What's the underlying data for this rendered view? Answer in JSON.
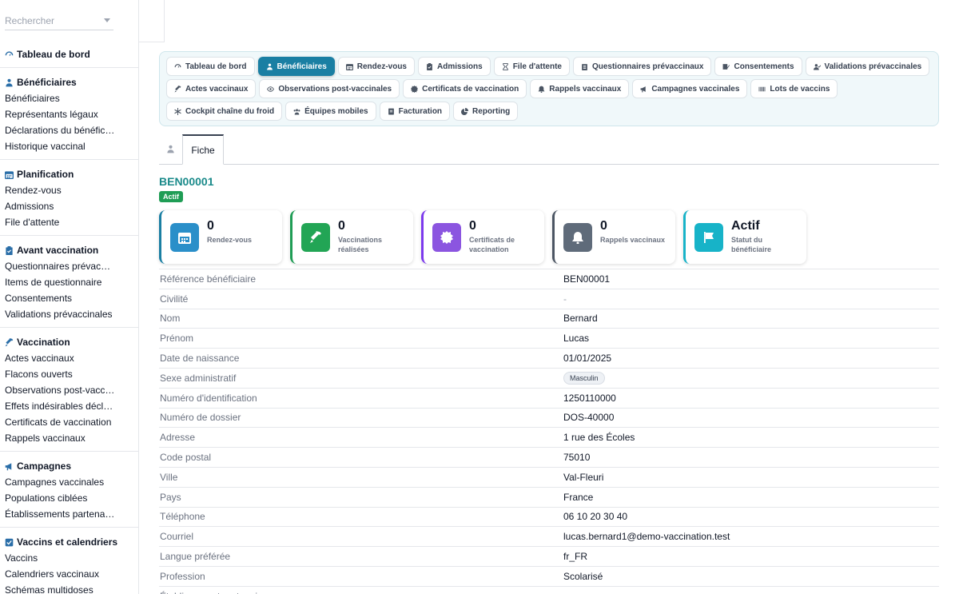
{
  "search": {
    "placeholder": "Rechercher"
  },
  "sidebar": {
    "top": "Tableau de bord",
    "sections": [
      {
        "title": "Bénéficiaires",
        "icon": "users-icon",
        "items": [
          "Bénéficiaires",
          "Représentants légaux",
          "Déclarations du bénéficia…",
          "Historique vaccinal"
        ]
      },
      {
        "title": "Planification",
        "icon": "calendar-icon",
        "items": [
          "Rendez-vous",
          "Admissions",
          "File d'attente"
        ]
      },
      {
        "title": "Avant vaccination",
        "icon": "clipboard-icon",
        "items": [
          "Questionnaires prévaccin…",
          "Items de questionnaire",
          "Consentements",
          "Validations prévaccinales"
        ]
      },
      {
        "title": "Vaccination",
        "icon": "syringe-icon",
        "items": [
          "Actes vaccinaux",
          "Flacons ouverts",
          "Observations post-vaccin…",
          "Effets indésirables déclarés",
          "Certificats de vaccination",
          "Rappels vaccinaux"
        ]
      },
      {
        "title": "Campagnes",
        "icon": "megaphone-icon",
        "items": [
          "Campagnes vaccinales",
          "Populations ciblées",
          "Établissements partenaires"
        ]
      },
      {
        "title": "Vaccins et calendriers",
        "icon": "check-square-icon",
        "items": [
          "Vaccins",
          "Calendriers vaccinaux",
          "Schémas multidoses"
        ]
      }
    ]
  },
  "tabs": [
    {
      "label": "Tableau de bord",
      "icon": "dashboard-icon",
      "active": false
    },
    {
      "label": "Bénéficiaires",
      "icon": "users-icon",
      "active": true
    },
    {
      "label": "Rendez-vous",
      "icon": "calendar-icon",
      "active": false
    },
    {
      "label": "Admissions",
      "icon": "clipboard-icon",
      "active": false
    },
    {
      "label": "File d'attente",
      "icon": "hourglass-icon",
      "active": false
    },
    {
      "label": "Questionnaires prévaccinaux",
      "icon": "clipboard-list-icon",
      "active": false
    },
    {
      "label": "Consentements",
      "icon": "signature-icon",
      "active": false
    },
    {
      "label": "Validations prévaccinales",
      "icon": "user-check-icon",
      "active": false
    },
    {
      "label": "Actes vaccinaux",
      "icon": "syringe-icon",
      "active": false
    },
    {
      "label": "Observations post-vaccinales",
      "icon": "eye-icon",
      "active": false
    },
    {
      "label": "Certificats de vaccination",
      "icon": "certificate-icon",
      "active": false
    },
    {
      "label": "Rappels vaccinaux",
      "icon": "bell-icon",
      "active": false
    },
    {
      "label": "Campagnes vaccinales",
      "icon": "megaphone-icon",
      "active": false
    },
    {
      "label": "Lots de vaccins",
      "icon": "barcode-icon",
      "active": false
    },
    {
      "label": "Cockpit chaîne du froid",
      "icon": "snowflake-icon",
      "active": false
    },
    {
      "label": "Équipes mobiles",
      "icon": "team-icon",
      "active": false
    },
    {
      "label": "Facturation",
      "icon": "invoice-icon",
      "active": false
    },
    {
      "label": "Reporting",
      "icon": "pie-chart-icon",
      "active": false
    }
  ],
  "subtabs": {
    "fiche": "Fiche"
  },
  "record": {
    "reference": "BEN00001",
    "status_badge": "Actif"
  },
  "cards": [
    {
      "value": "0",
      "label": "Rendez-vous",
      "icon": "calendar-icon",
      "color": "#2a8fc9",
      "border": "#1a7fa3"
    },
    {
      "value": "0",
      "label": "Vaccinations réalisées",
      "icon": "syringe-icon",
      "color": "#22a555",
      "border": "#1f9d55"
    },
    {
      "value": "0",
      "label": "Certificats de vaccination",
      "icon": "certificate-icon",
      "color": "#8b55e0",
      "border": "#7c3aed"
    },
    {
      "value": "0",
      "label": "Rappels vaccinaux",
      "icon": "bell-icon",
      "color": "#5f6b7a",
      "border": "#4b5563"
    },
    {
      "value": "Actif",
      "label": "Statut du bénéficiaire",
      "icon": "flag-icon",
      "color": "#17b3c8",
      "border": "#17b3c8"
    }
  ],
  "fields": [
    {
      "label": "Référence bénéficiaire",
      "value": "BEN00001"
    },
    {
      "label": "Civilité",
      "value": "-"
    },
    {
      "label": "Nom",
      "value": "Bernard"
    },
    {
      "label": "Prénom",
      "value": "Lucas"
    },
    {
      "label": "Date de naissance",
      "value": "01/01/2025"
    },
    {
      "label": "Sexe administratif",
      "value": "Masculin",
      "pill": true
    },
    {
      "label": "Numéro d'identification",
      "value": "1250110000"
    },
    {
      "label": "Numéro de dossier",
      "value": "DOS-40000"
    },
    {
      "label": "Adresse",
      "value": "1 rue des Écoles"
    },
    {
      "label": "Code postal",
      "value": "75010"
    },
    {
      "label": "Ville",
      "value": "Val-Fleuri"
    },
    {
      "label": "Pays",
      "value": "France"
    },
    {
      "label": "Téléphone",
      "value": "06 10 20 30 40"
    },
    {
      "label": "Courriel",
      "value": "lucas.bernard1@demo-vaccination.test"
    },
    {
      "label": "Langue préférée",
      "value": "fr_FR"
    },
    {
      "label": "Profession",
      "value": "Scolarisé"
    },
    {
      "label": "Établissement partenaire",
      "value": ""
    }
  ]
}
